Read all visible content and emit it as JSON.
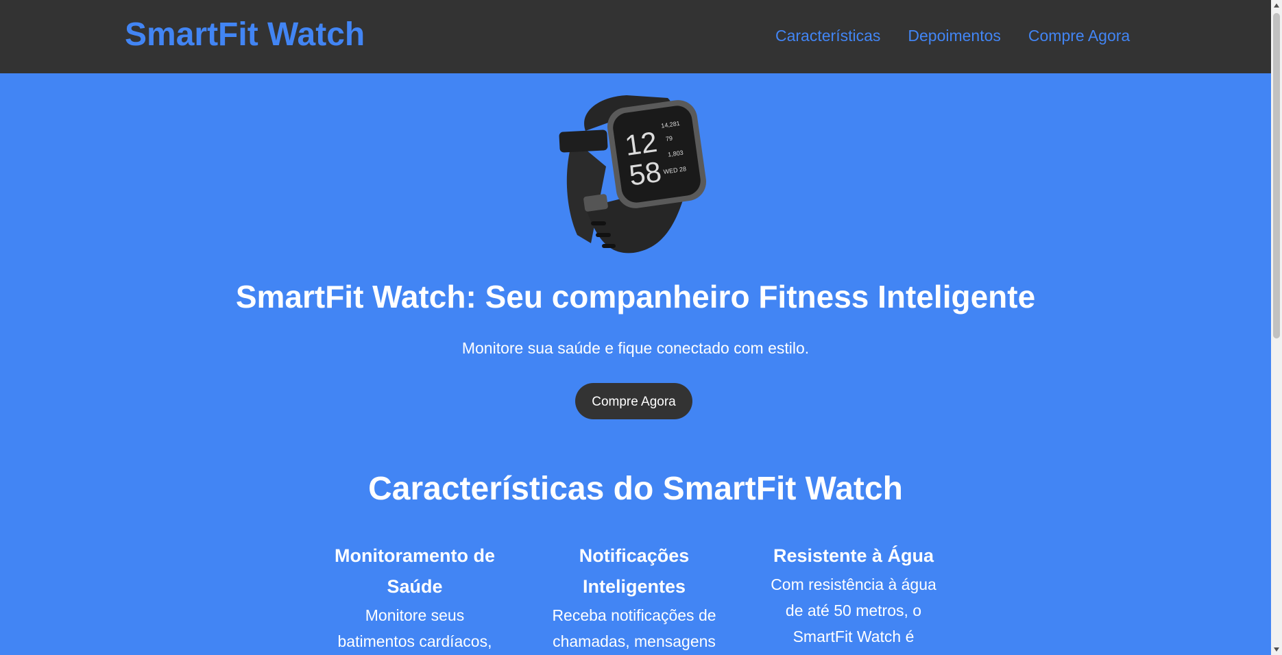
{
  "header": {
    "logo": "SmartFit Watch",
    "nav": [
      "Características",
      "Depoimentos",
      "Compre Agora"
    ]
  },
  "hero": {
    "image_icon": "smartwatch-image",
    "watch_face": {
      "hour": "12",
      "minute": "58",
      "steps": "14,281",
      "heart": "79",
      "calories": "1,803",
      "date": "WED 28"
    },
    "title": "SmartFit Watch: Seu companheiro Fitness Inteligente",
    "subtitle": "Monitore sua saúde e fique conectado com estilo.",
    "cta": "Compre Agora"
  },
  "features": {
    "title": "Características do SmartFit Watch",
    "items": [
      {
        "title_line1": "Monitoramento de",
        "title_line2": "Saúde",
        "line1": "Monitore seus",
        "line2": "batimentos cardíacos,"
      },
      {
        "title_line1": "Notificações",
        "title_line2": "Inteligentes",
        "line1": "Receba notificações de",
        "line2": "chamadas, mensagens"
      },
      {
        "title_line1": "Resistente à Água",
        "line1": "Com resistência à água",
        "line2": "de até 50 metros, o",
        "line3": "SmartFit Watch é"
      }
    ]
  },
  "colors": {
    "primary": "#4285f4",
    "dark": "#333333",
    "text_light": "#ffffff"
  }
}
